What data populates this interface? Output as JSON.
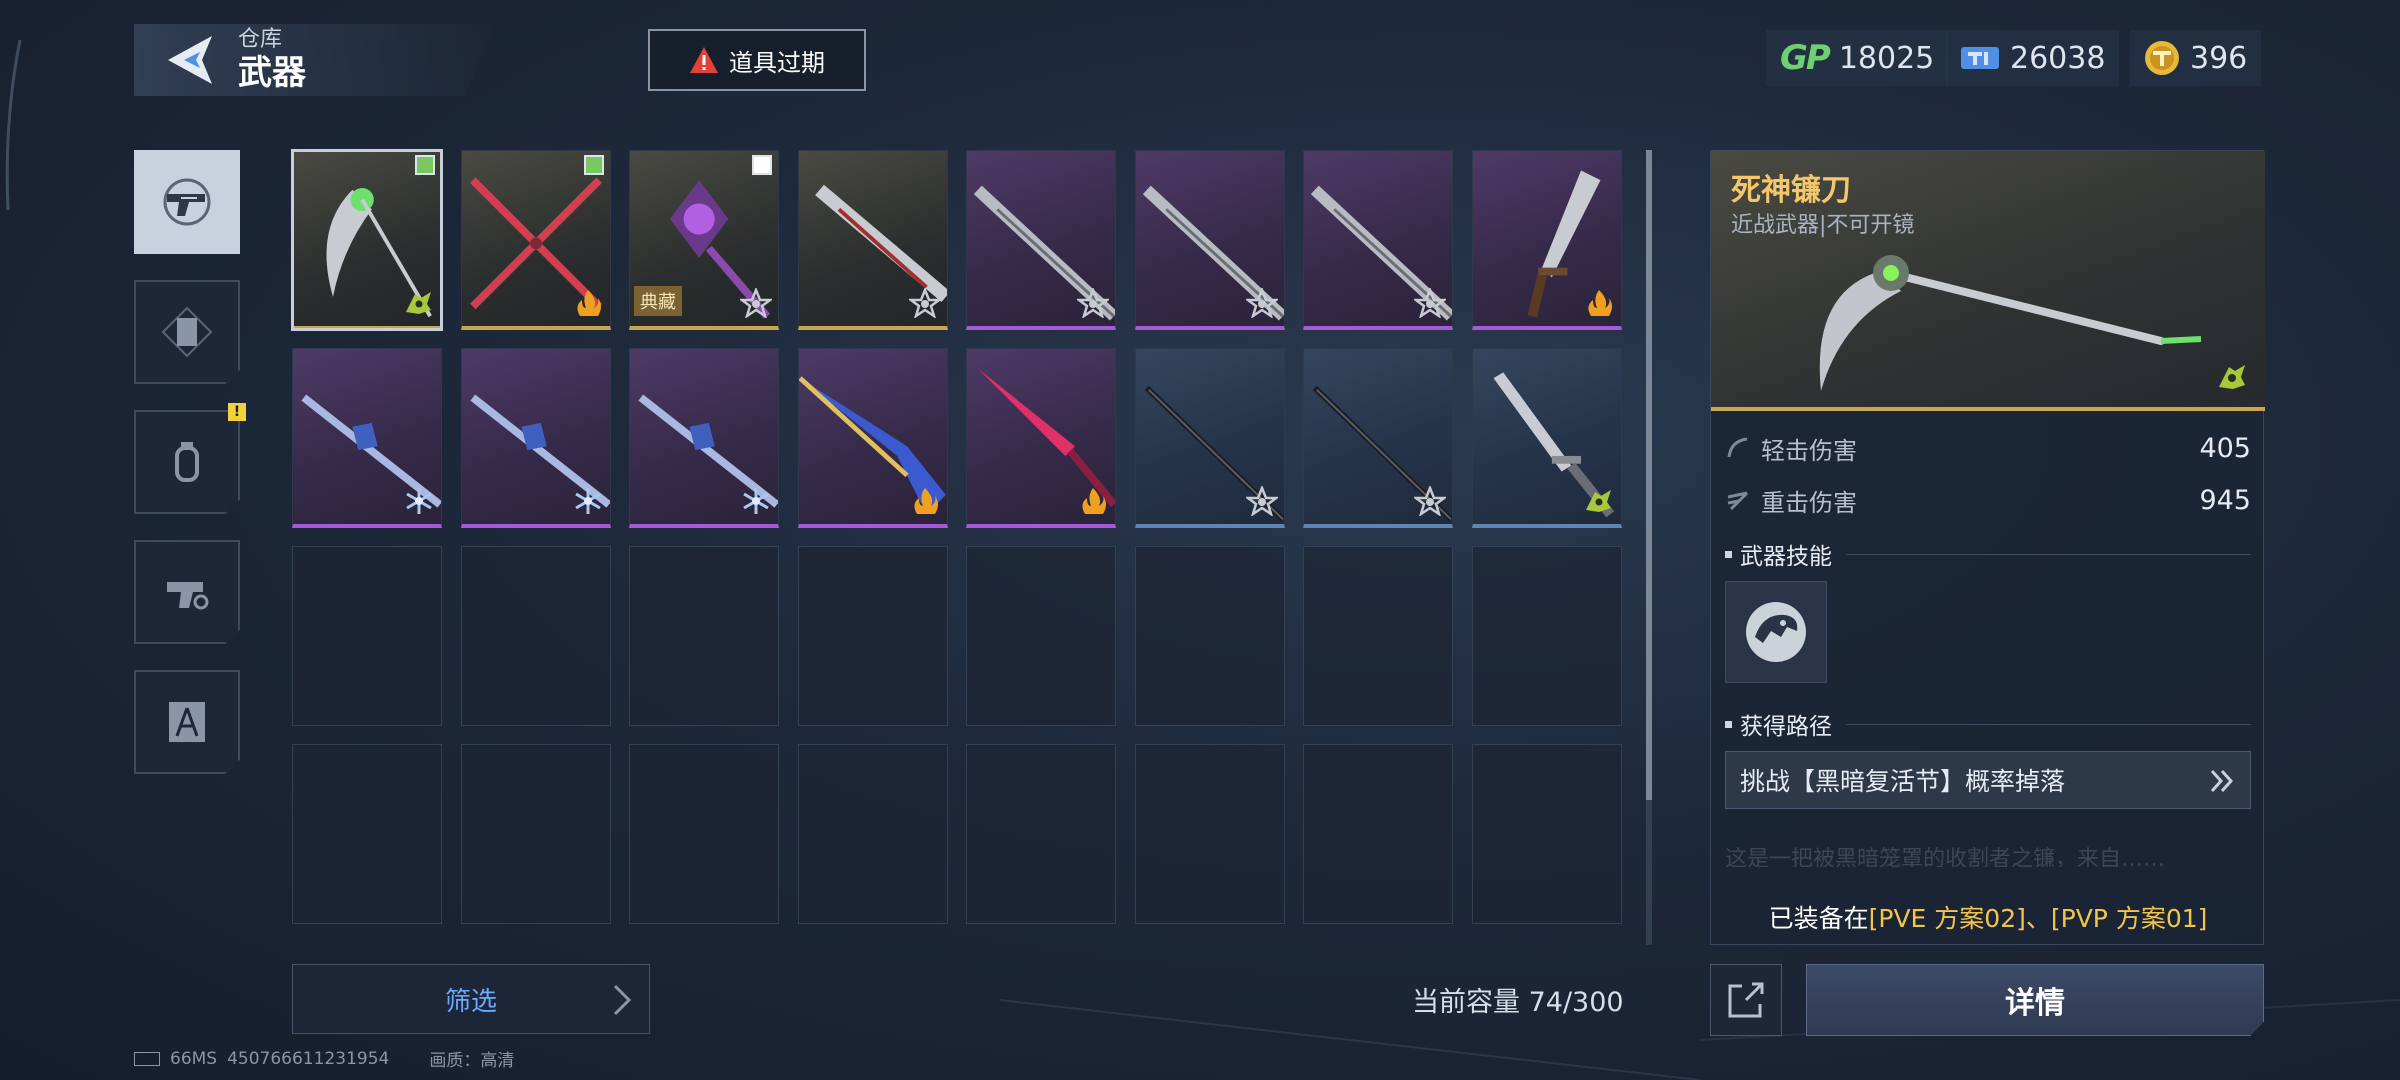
{
  "header": {
    "subtitle": "仓库",
    "title": "武器"
  },
  "expire_button": "道具过期",
  "currencies": {
    "gp": "18025",
    "ticket": "26038",
    "coin": "396"
  },
  "categories": [
    {
      "name": "weapon",
      "active": true
    },
    {
      "name": "card",
      "active": false
    },
    {
      "name": "grenade",
      "active": false,
      "badge": "!"
    },
    {
      "name": "gun-parts",
      "active": false
    },
    {
      "name": "blueprint",
      "active": false
    }
  ],
  "inventory": [
    {
      "rarity": "gold",
      "check": "on",
      "type": "biohazard",
      "selected": true
    },
    {
      "rarity": "gold",
      "check": "on",
      "type": "fire"
    },
    {
      "rarity": "gold",
      "check": "off",
      "type": "star",
      "tag": "典藏"
    },
    {
      "rarity": "gold",
      "type": "star"
    },
    {
      "rarity": "purple",
      "type": "star"
    },
    {
      "rarity": "purple",
      "type": "star"
    },
    {
      "rarity": "purple",
      "type": "star"
    },
    {
      "rarity": "purple",
      "type": "fire"
    },
    {
      "rarity": "purple",
      "type": "ice"
    },
    {
      "rarity": "purple",
      "type": "ice"
    },
    {
      "rarity": "purple",
      "type": "ice"
    },
    {
      "rarity": "purple",
      "type": "fire"
    },
    {
      "rarity": "purple",
      "type": "fire"
    },
    {
      "rarity": "blue",
      "type": "star"
    },
    {
      "rarity": "blue",
      "type": "star"
    },
    {
      "rarity": "blue",
      "type": "biohazard"
    }
  ],
  "empty_slots": 16,
  "filter_label": "筛选",
  "capacity": "当前容量 74/300",
  "detail": {
    "name": "死神镰刀",
    "subtitle": "近战武器|不可开镜",
    "stats": [
      {
        "label": "轻击伤害",
        "value": "405"
      },
      {
        "label": "重击伤害",
        "value": "945"
      }
    ],
    "skill_heading": "武器技能",
    "source_heading": "获得路径",
    "source_text": "挑战【黑暗复活节】概率掉落",
    "faded_text": "这是一把被黑暗笼罩的收割者之镰，来自……",
    "equipped_prefix": "已装备在",
    "equipped_plans": "[PVE 方案02]、[PVP 方案01]",
    "detail_button": "详情"
  },
  "footer": {
    "ping": "66MS",
    "uid": "450766611231954",
    "quality": "画质：高清"
  },
  "colors": {
    "gold": "#c9a54e",
    "purple": "#a65ad8",
    "blue": "#5d86b4",
    "accent": "#f2c64c",
    "filter": "#6aa8ff"
  }
}
